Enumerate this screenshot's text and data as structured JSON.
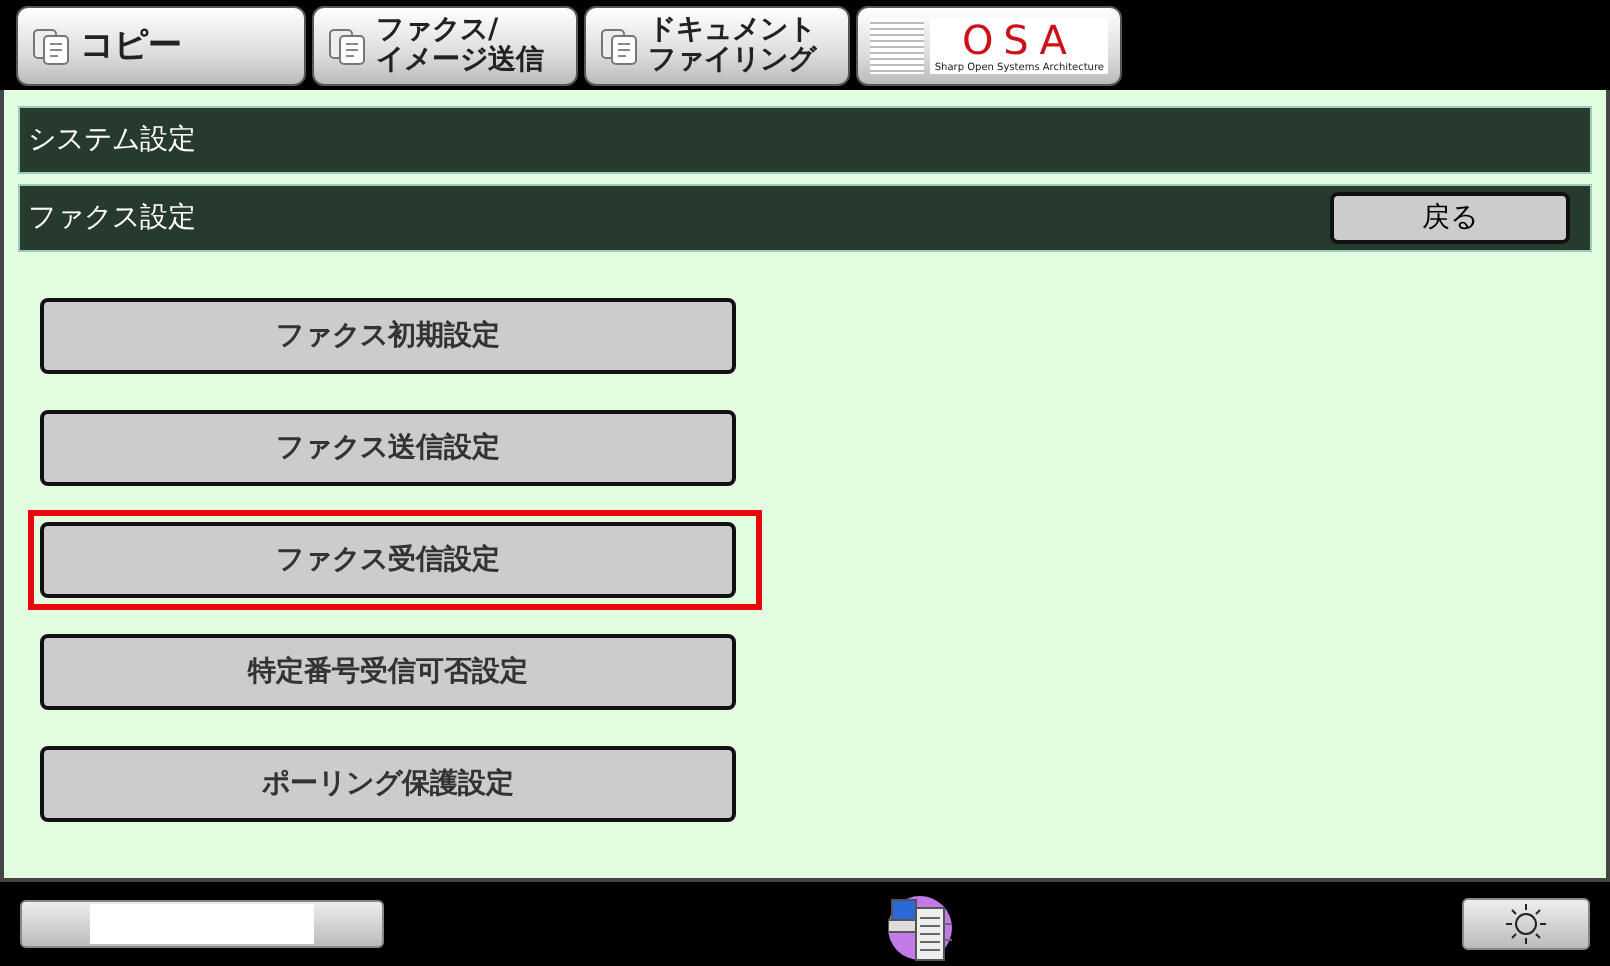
{
  "tabs": [
    {
      "kind": "text",
      "lines": [
        "コピー"
      ]
    },
    {
      "kind": "text",
      "lines": [
        "ファクス/",
        "イメージ送信"
      ]
    },
    {
      "kind": "text",
      "lines": [
        "ドキュメント",
        "ファイリング"
      ]
    },
    {
      "kind": "logo",
      "lines": [
        "OSA",
        "Sharp Open Systems Architecture"
      ]
    }
  ],
  "header": {
    "title": "システム設定"
  },
  "subheader": {
    "title": "ファクス設定",
    "back_button": "戻る"
  },
  "menu_items": [
    {
      "label": "ファクス初期設定",
      "highlighted": false
    },
    {
      "label": "ファクス送信設定",
      "highlighted": false
    },
    {
      "label": "ファクス受信設定",
      "highlighted": true
    },
    {
      "label": "特定番号受信可否設定",
      "highlighted": false
    },
    {
      "label": "ポーリング保護設定",
      "highlighted": false
    }
  ]
}
